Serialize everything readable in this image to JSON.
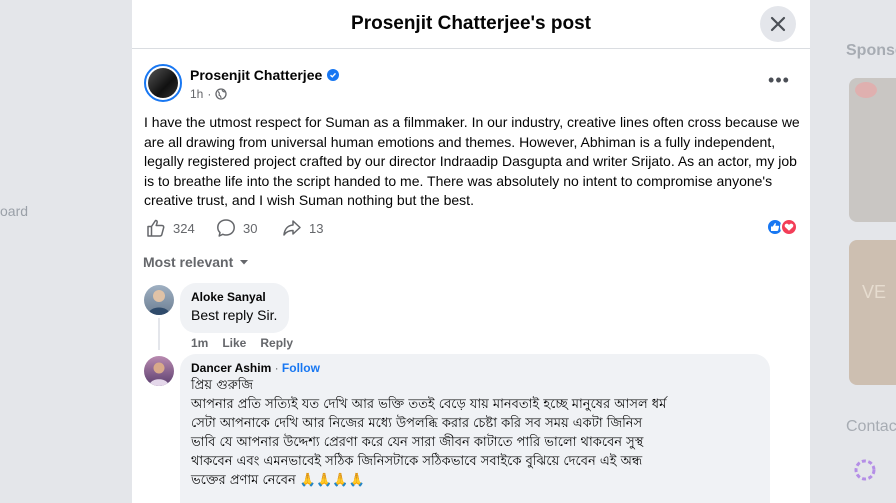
{
  "background": {
    "left_label": "oard",
    "sponsored": "Sponso",
    "ad_text": "VE",
    "contacts": "Contac"
  },
  "modal": {
    "title": "Prosenjit Chatterjee's post"
  },
  "post": {
    "author": "Prosenjit Chatterjee",
    "time": "1h",
    "more": "•••",
    "body": "I have the utmost respect for Suman as a filmmaker. In our industry, creative lines often cross because we are all drawing from universal human emotions and themes. However, Abhiman is a fully independent, legally registered project crafted by our director Indraadip Dasgupta and writer Srijato. As an actor, my job is to breathe life into the script handed to me. There was absolutely no intent to compromise anyone's creative trust, and I wish Suman nothing but the best.",
    "likes": "324",
    "comments": "30",
    "shares": "13"
  },
  "sort_label": "Most relevant",
  "comments": [
    {
      "name": "Aloke Sanyal",
      "text": "Best reply Sir.",
      "time": "1m",
      "like": "Like",
      "reply": "Reply"
    },
    {
      "name": "Dancer Ashim",
      "dot": " · ",
      "follow": "Follow",
      "lines": [
        "প্রিয় গুরুজি",
        "আপনার প্রতি সত্যিই যত দেখি আর ভক্তি ততই বেড়ে যায় মানবতাই হচ্ছে মানুষের আসল ধর্ম",
        "সেটা আপনাকে দেখি আর নিজের মধ্যে উপলব্ধি করার চেষ্টা করি সব সময় একটা জিনিস",
        "ভাবি যে আপনার উদ্দেশ্য প্রেরণা করে যেন সারা জীবন কাটাতে পারি ভালো থাকবেন সুস্থ",
        "থাকবেন এবং এমনভাবেই সঠিক জিনিসটাকে সঠিকভাবে সবাইকে বুঝিয়ে দেবেন এই অন্ধ",
        "ভক্তের প্রণাম নেবেন 🙏🙏🙏🙏"
      ]
    }
  ],
  "colors": {
    "accent": "#1877f2",
    "love": "#f33e58",
    "secondary_text": "#65676b"
  }
}
